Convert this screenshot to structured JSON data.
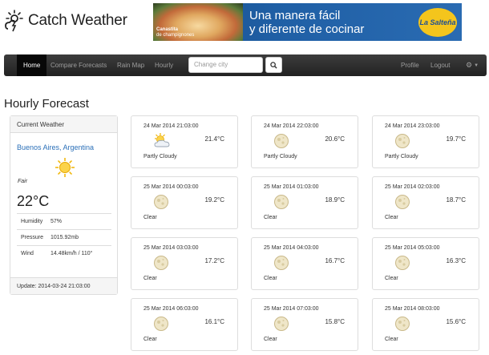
{
  "app": {
    "name": "Catch Weather"
  },
  "ad": {
    "product": "Canastita",
    "product_sub": "de champignones",
    "headline_line1": "Una manera fácil",
    "headline_line2": "y diferente de cocinar",
    "brand": "La Salteña"
  },
  "nav": {
    "items": [
      "Home",
      "Compare Forecasts",
      "Rain Map",
      "Hourly"
    ],
    "search_placeholder": "Change city",
    "profile": "Profile",
    "logout": "Logout",
    "settings_icon": "gear-icon"
  },
  "page_title": "Hourly Forecast",
  "current": {
    "header": "Current Weather",
    "city": "Buenos Aires, Argentina",
    "condition": "Fair",
    "temp": "22°C",
    "rows": [
      {
        "label": "Humidity",
        "value": "57%"
      },
      {
        "label": "Pressure",
        "value": "1015.92mb"
      },
      {
        "label": "Wind",
        "value": "14.48km/h / 110°"
      }
    ],
    "update_label": "Update:",
    "update_value": "2014-03-24 21:03:00"
  },
  "forecasts": [
    {
      "date": "24 Mar 2014 21:03:00",
      "temp": "21.4°C",
      "cond": "Partly Cloudy",
      "icon": "partly-cloudy-icon"
    },
    {
      "date": "24 Mar 2014 22:03:00",
      "temp": "20.6°C",
      "cond": "Partly Cloudy",
      "icon": "moon-icon"
    },
    {
      "date": "24 Mar 2014 23:03:00",
      "temp": "19.7°C",
      "cond": "Partly Cloudy",
      "icon": "moon-icon"
    },
    {
      "date": "25 Mar 2014 00:03:00",
      "temp": "19.2°C",
      "cond": "Clear",
      "icon": "moon-icon"
    },
    {
      "date": "25 Mar 2014 01:03:00",
      "temp": "18.9°C",
      "cond": "Clear",
      "icon": "moon-icon"
    },
    {
      "date": "25 Mar 2014 02:03:00",
      "temp": "18.7°C",
      "cond": "Clear",
      "icon": "moon-icon"
    },
    {
      "date": "25 Mar 2014 03:03:00",
      "temp": "17.2°C",
      "cond": "Clear",
      "icon": "moon-icon"
    },
    {
      "date": "25 Mar 2014 04:03:00",
      "temp": "16.7°C",
      "cond": "Clear",
      "icon": "moon-icon"
    },
    {
      "date": "25 Mar 2014 05:03:00",
      "temp": "16.3°C",
      "cond": "Clear",
      "icon": "moon-icon"
    },
    {
      "date": "25 Mar 2014 06:03:00",
      "temp": "16.1°C",
      "cond": "Clear",
      "icon": "moon-icon"
    },
    {
      "date": "25 Mar 2014 07:03:00",
      "temp": "15.8°C",
      "cond": "Clear",
      "icon": "moon-icon"
    },
    {
      "date": "25 Mar 2014 08:03:00",
      "temp": "15.6°C",
      "cond": "Clear",
      "icon": "moon-icon"
    }
  ],
  "colors": {
    "link": "#2a6fb8",
    "navbar": "#222222",
    "ad_blue": "#1f5fa5",
    "brand_yellow": "#f4c51c"
  }
}
